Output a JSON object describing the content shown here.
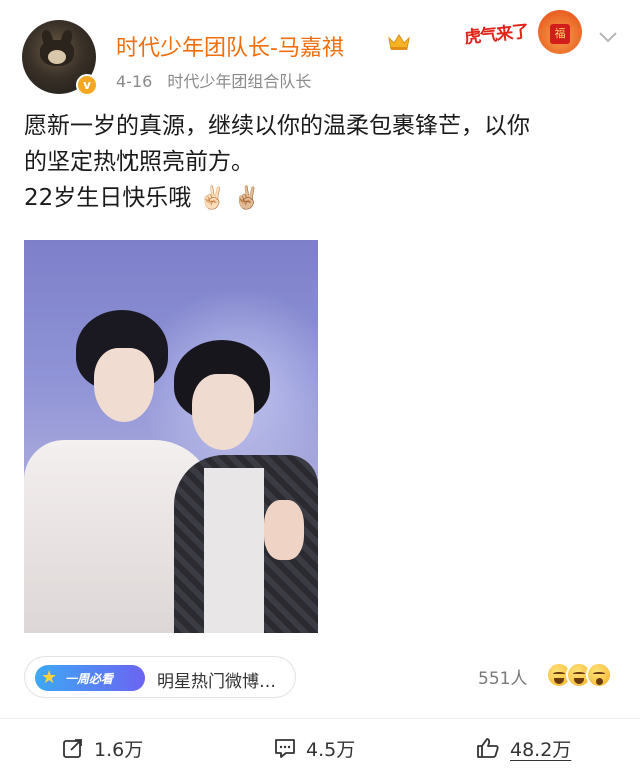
{
  "post": {
    "author": "时代少年团队长-马嘉祺",
    "date": "4-16",
    "source": "时代少年团组合队长",
    "verified_badge": "v",
    "festival_badge": "虎气来了",
    "text_line1": "愿新一岁的真源，继续以你的温柔包裹锋芒，以你",
    "text_line2": "的坚定热忱照亮前方。",
    "text_line3": "22岁生日快乐哦",
    "emoji": "✌🏻 ✌🏼"
  },
  "topic": {
    "tag": "一周必看",
    "label": "明星热门微博…"
  },
  "reactions": {
    "count_label": "551人"
  },
  "actions": {
    "share": "1.6万",
    "comment": "4.5万",
    "like": "48.2万"
  },
  "icons": {
    "crown": "crown-icon",
    "chevron": "chevron-down-icon",
    "share": "share-icon",
    "comment": "comment-icon",
    "like": "thumbs-up-icon"
  },
  "colors": {
    "username": "#f06e0e",
    "meta": "#8a8a8a",
    "badge": "#f5a623"
  }
}
